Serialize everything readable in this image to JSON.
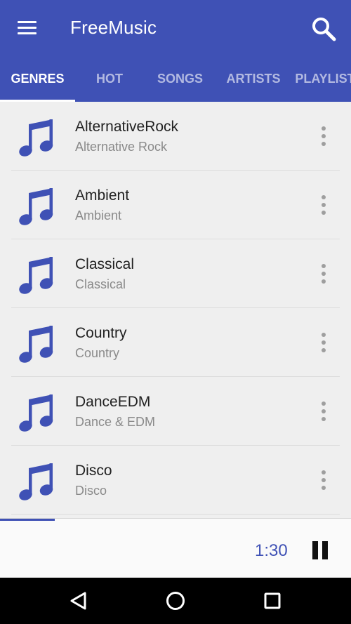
{
  "app": {
    "title": "FreeMusic"
  },
  "colors": {
    "primary": "#3f51b5",
    "accent": "#3f51b5",
    "background": "#efefef"
  },
  "icons": {
    "menu": "hamburger-menu-icon",
    "search": "search-icon",
    "genre_item": "music-note-icon",
    "overflow": "more-vert-icon",
    "pause": "pause-icon",
    "back": "back-triangle-icon",
    "home": "home-circle-icon",
    "recents": "recents-square-icon"
  },
  "tabs": [
    {
      "label": "GENRES",
      "active": true
    },
    {
      "label": "HOT",
      "active": false
    },
    {
      "label": "SONGS",
      "active": false
    },
    {
      "label": "ARTISTS",
      "active": false
    },
    {
      "label": "PLAYLISTS",
      "active": false
    }
  ],
  "genres": [
    {
      "title": "AlternativeRock",
      "subtitle": "Alternative Rock"
    },
    {
      "title": "Ambient",
      "subtitle": "Ambient"
    },
    {
      "title": "Classical",
      "subtitle": "Classical"
    },
    {
      "title": "Country",
      "subtitle": "Country"
    },
    {
      "title": "DanceEDM",
      "subtitle": "Dance & EDM"
    },
    {
      "title": "Disco",
      "subtitle": "Disco"
    }
  ],
  "player": {
    "time": "1:30",
    "progress": 0.156,
    "state": "playing"
  }
}
